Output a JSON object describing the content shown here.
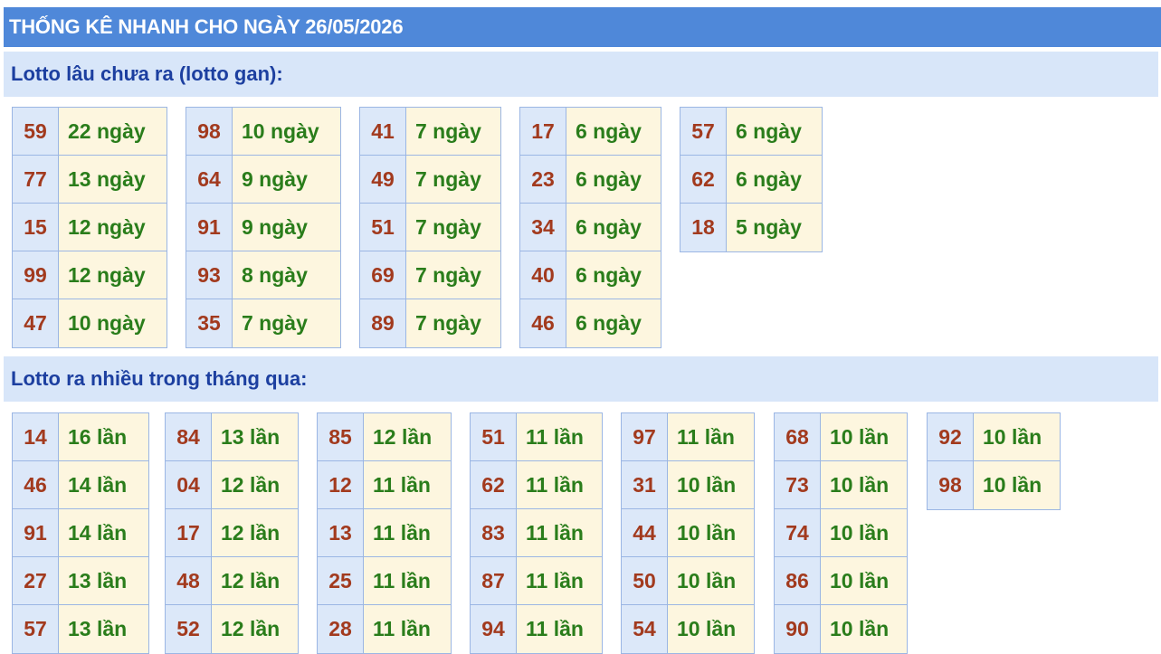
{
  "header": {
    "title": "THỐNG KÊ NHANH CHO NGÀY 26/05/2026"
  },
  "gan": {
    "title": "Lotto lâu chưa ra (lotto gan):",
    "groups": [
      [
        {
          "num": "59",
          "val": "22 ngày"
        },
        {
          "num": "77",
          "val": "13 ngày"
        },
        {
          "num": "15",
          "val": "12 ngày"
        },
        {
          "num": "99",
          "val": "12 ngày"
        },
        {
          "num": "47",
          "val": "10 ngày"
        }
      ],
      [
        {
          "num": "98",
          "val": "10 ngày"
        },
        {
          "num": "64",
          "val": "9 ngày"
        },
        {
          "num": "91",
          "val": "9 ngày"
        },
        {
          "num": "93",
          "val": "8 ngày"
        },
        {
          "num": "35",
          "val": "7 ngày"
        }
      ],
      [
        {
          "num": "41",
          "val": "7 ngày"
        },
        {
          "num": "49",
          "val": "7 ngày"
        },
        {
          "num": "51",
          "val": "7 ngày"
        },
        {
          "num": "69",
          "val": "7 ngày"
        },
        {
          "num": "89",
          "val": "7 ngày"
        }
      ],
      [
        {
          "num": "17",
          "val": "6 ngày"
        },
        {
          "num": "23",
          "val": "6 ngày"
        },
        {
          "num": "34",
          "val": "6 ngày"
        },
        {
          "num": "40",
          "val": "6 ngày"
        },
        {
          "num": "46",
          "val": "6 ngày"
        }
      ],
      [
        {
          "num": "57",
          "val": "6 ngày"
        },
        {
          "num": "62",
          "val": "6 ngày"
        },
        {
          "num": "18",
          "val": "5 ngày"
        }
      ]
    ]
  },
  "frequent": {
    "title": "Lotto ra nhiều trong tháng qua:",
    "groups": [
      [
        {
          "num": "14",
          "val": "16 lần"
        },
        {
          "num": "46",
          "val": "14 lần"
        },
        {
          "num": "91",
          "val": "14 lần"
        },
        {
          "num": "27",
          "val": "13 lần"
        },
        {
          "num": "57",
          "val": "13 lần"
        }
      ],
      [
        {
          "num": "84",
          "val": "13 lần"
        },
        {
          "num": "04",
          "val": "12 lần"
        },
        {
          "num": "17",
          "val": "12 lần"
        },
        {
          "num": "48",
          "val": "12 lần"
        },
        {
          "num": "52",
          "val": "12 lần"
        }
      ],
      [
        {
          "num": "85",
          "val": "12 lần"
        },
        {
          "num": "12",
          "val": "11 lần"
        },
        {
          "num": "13",
          "val": "11 lần"
        },
        {
          "num": "25",
          "val": "11 lần"
        },
        {
          "num": "28",
          "val": "11 lần"
        }
      ],
      [
        {
          "num": "51",
          "val": "11 lần"
        },
        {
          "num": "62",
          "val": "11 lần"
        },
        {
          "num": "83",
          "val": "11 lần"
        },
        {
          "num": "87",
          "val": "11 lần"
        },
        {
          "num": "94",
          "val": "11 lần"
        }
      ],
      [
        {
          "num": "97",
          "val": "11 lần"
        },
        {
          "num": "31",
          "val": "10 lần"
        },
        {
          "num": "44",
          "val": "10 lần"
        },
        {
          "num": "50",
          "val": "10 lần"
        },
        {
          "num": "54",
          "val": "10 lần"
        }
      ],
      [
        {
          "num": "68",
          "val": "10 lần"
        },
        {
          "num": "73",
          "val": "10 lần"
        },
        {
          "num": "74",
          "val": "10 lần"
        },
        {
          "num": "86",
          "val": "10 lần"
        },
        {
          "num": "90",
          "val": "10 lần"
        }
      ],
      [
        {
          "num": "92",
          "val": "10 lần"
        },
        {
          "num": "98",
          "val": "10 lần"
        }
      ]
    ]
  }
}
